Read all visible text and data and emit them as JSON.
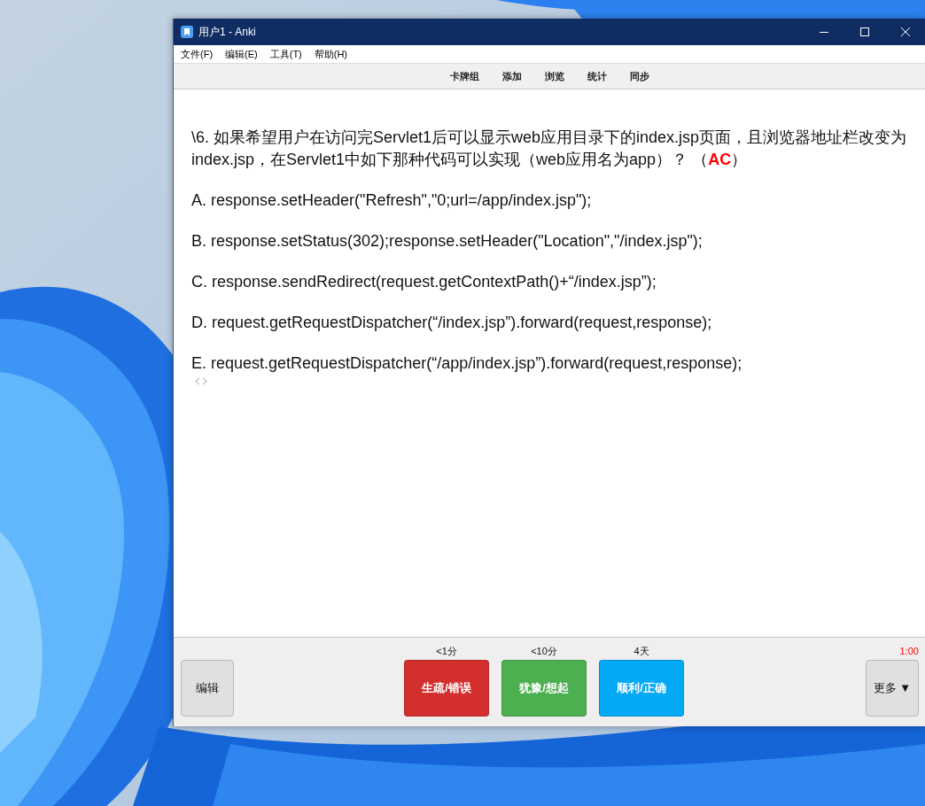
{
  "window": {
    "title": "用户1 - Anki"
  },
  "menu": [
    {
      "label": "文件(F)"
    },
    {
      "label": "编辑(E)"
    },
    {
      "label": "工具(T)"
    },
    {
      "label": "帮助(H)"
    }
  ],
  "toolbar": [
    {
      "label": "卡牌组"
    },
    {
      "label": "添加"
    },
    {
      "label": "浏览"
    },
    {
      "label": "统计"
    },
    {
      "label": "同步"
    }
  ],
  "card": {
    "question": "\\6. 如果希望用户在访问完Servlet1后可以显示web应用目录下的index.jsp页面，且浏览器地址栏改变为index.jsp，在Servlet1中如下那种代码可以实现（web应用名为app）？ （**AC**）",
    "options": [
      "A. response.setHeader(\"Refresh\",\"0;url=/app/index.jsp\");",
      "B. response.setStatus(302);response.setHeader(\"Location\",\"/index.jsp\");",
      "C. response.sendRedirect(request.getContextPath()+“/index.jsp”);",
      "D. request.getRequestDispatcher(“/index.jsp”).forward(request,response);",
      "E. request.getRequestDispatcher(“/app/index.jsp”).forward(request,response);"
    ]
  },
  "bottom_bar": {
    "edit_button": "编辑",
    "answers": [
      {
        "interval": "<1分",
        "label": "生疏/错误",
        "color": "#d32f2f"
      },
      {
        "interval": "<10分",
        "label": "犹豫/想起",
        "color": "#4caf50"
      },
      {
        "interval": "4天",
        "label": "顺利/正确",
        "color": "#03a9f4"
      }
    ],
    "timer": "1:00",
    "more_button": "更多 ▼"
  }
}
